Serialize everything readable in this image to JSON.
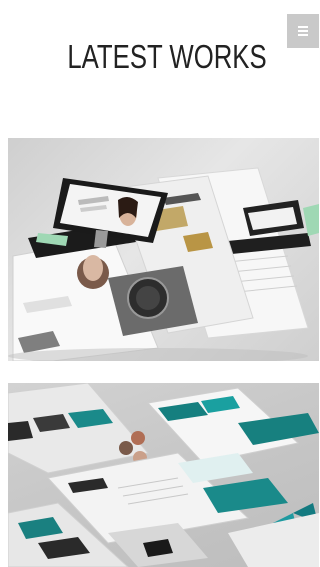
{
  "header": {
    "title": "LATEST WORKS",
    "menu_icon": "hamburger-menu-icon"
  },
  "works": [
    {
      "name": "portfolio-item-1",
      "style": "isometric website mockups — fashion / watch layouts",
      "accent": "#8fd4a8"
    },
    {
      "name": "portfolio-item-2",
      "style": "isometric website mockups — teal corporate layouts",
      "accent": "#1e8c8c"
    }
  ]
}
